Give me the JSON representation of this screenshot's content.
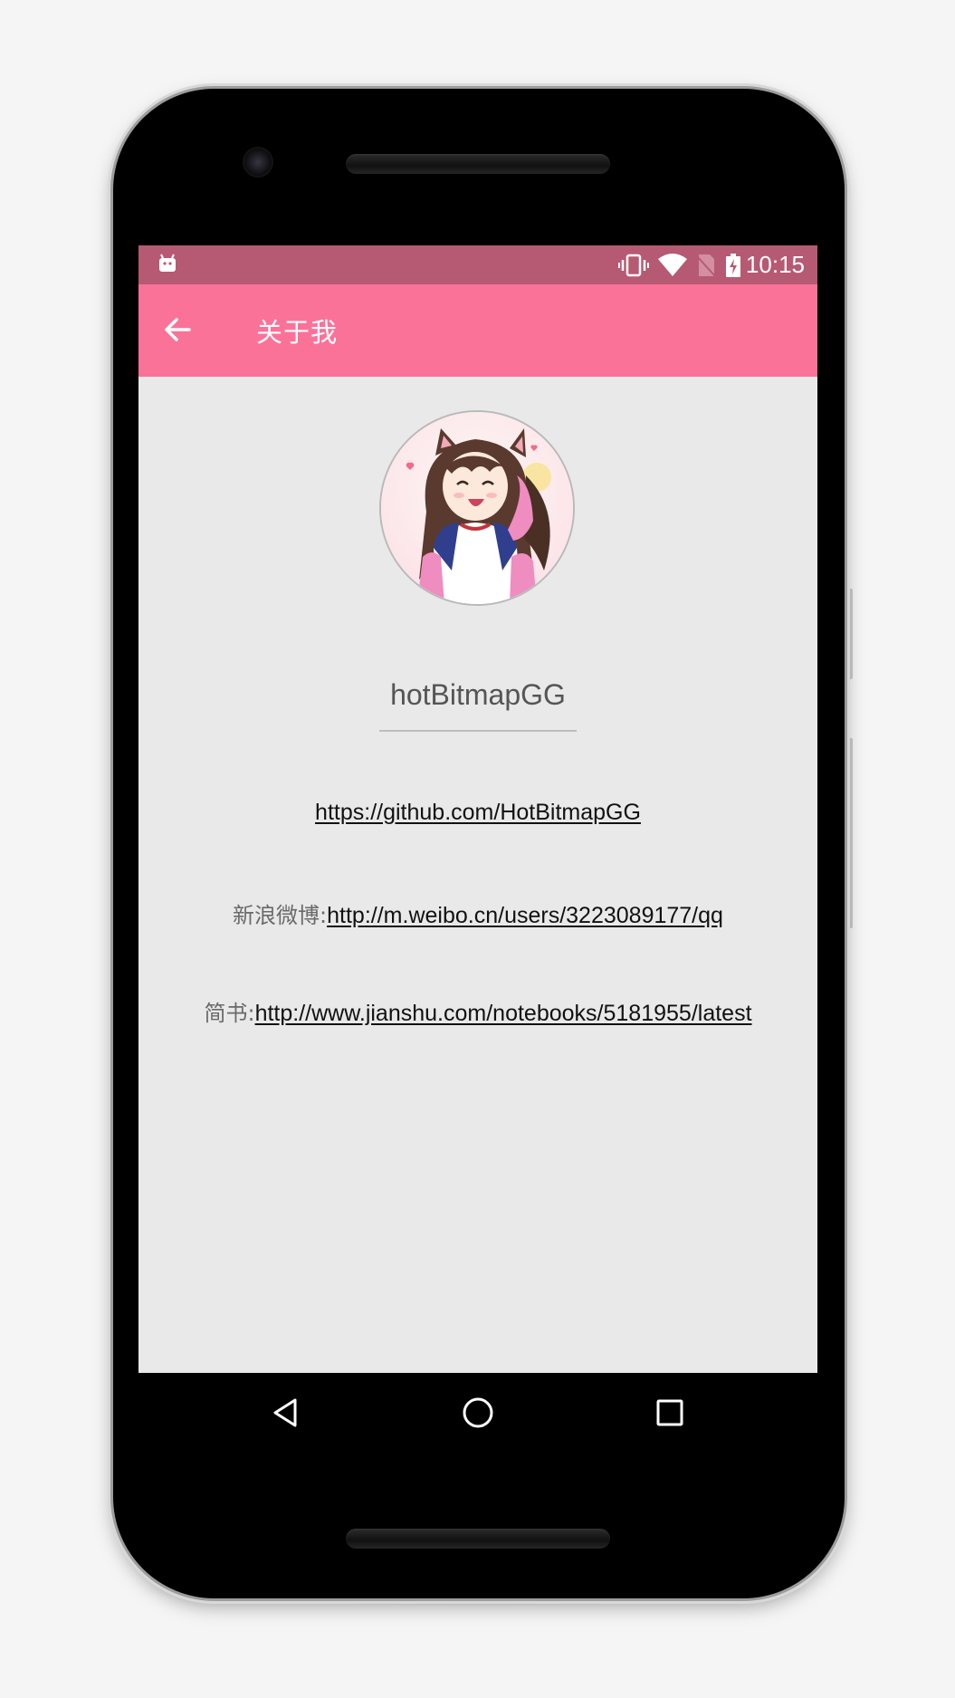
{
  "status_bar": {
    "time": "10:15",
    "icons": [
      "android-debug-icon",
      "vibrate-icon",
      "wifi-icon",
      "no-sim-icon",
      "battery-charging-icon"
    ]
  },
  "app_bar": {
    "title": "关于我",
    "back_icon": "arrow-back-icon"
  },
  "profile": {
    "avatar_icon": "anime-girl-avatar",
    "username": "hotBitmapGG"
  },
  "links": [
    {
      "prefix": "",
      "url": "https://github.com/HotBitmapGG"
    },
    {
      "prefix": "新浪微博:",
      "url": "http://m.weibo.cn/users/3223089177/qq"
    },
    {
      "prefix": "简书:",
      "url": "http://www.jianshu.com/notebooks/5181955/latest"
    }
  ],
  "nav_bar": {
    "icons": [
      "back-triangle-icon",
      "home-circle-icon",
      "recents-square-icon"
    ]
  },
  "colors": {
    "status_bar": "#b65a73",
    "app_bar": "#fb7299",
    "screen_bg": "#e9e9e9"
  }
}
